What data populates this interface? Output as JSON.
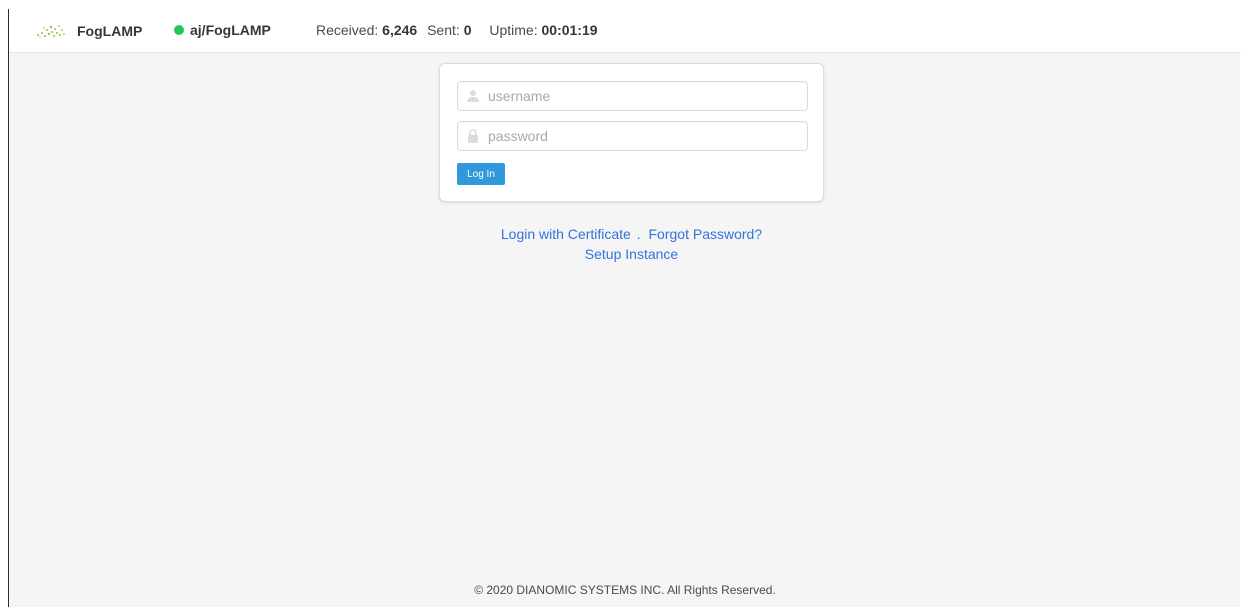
{
  "navbar": {
    "brand_name": "FogLAMP",
    "instance_name": "aj/FogLAMP",
    "instance_status_color": "#23c65a",
    "received_label": "Received:",
    "received_value": "6,246",
    "sent_label": "Sent:",
    "sent_value": "0",
    "uptime_label": "Uptime:",
    "uptime_value": "00:01:19"
  },
  "login_form": {
    "username_placeholder": "username",
    "username_value": "",
    "password_placeholder": "password",
    "password_value": "",
    "login_button_label": "Log In",
    "accent_color": "#3298dc"
  },
  "links": {
    "certificate_login": "Login with Certificate",
    "separator": ".",
    "forgot_password": "Forgot Password?",
    "setup_instance": "Setup Instance"
  },
  "footer": {
    "copyright": "© 2020 DIANOMIC SYSTEMS INC. All Rights Reserved."
  },
  "icons": {
    "brand": "foglamp-logo-icon",
    "status": "status-dot-icon",
    "username": "user-icon",
    "password": "lock-icon"
  }
}
